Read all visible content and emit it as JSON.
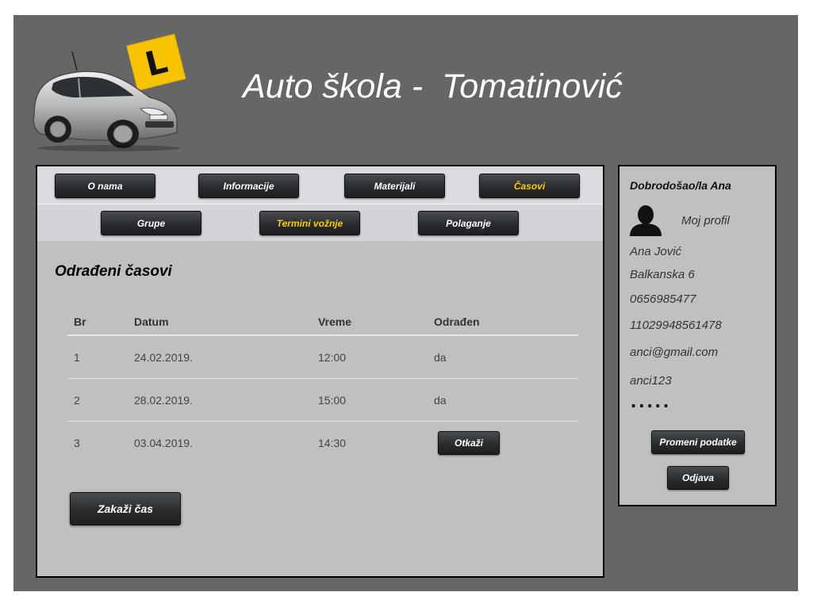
{
  "header": {
    "title": "Auto škola -  Tomatinović",
    "logo_badge": "L"
  },
  "nav": {
    "row1": [
      {
        "label": "O nama",
        "active": false
      },
      {
        "label": "Informacije",
        "active": false
      },
      {
        "label": "Materijali",
        "active": false
      },
      {
        "label": "Časovi",
        "active": true
      }
    ],
    "row2": [
      {
        "label": "Grupe",
        "active": false
      },
      {
        "label": "Termini vožnje",
        "active": true
      },
      {
        "label": "Polaganje",
        "active": false
      }
    ]
  },
  "main": {
    "section_title": "Odrađeni časovi",
    "table": {
      "columns": [
        "Br",
        "Datum",
        "Vreme",
        "Odrađen"
      ],
      "rows": [
        {
          "br": "1",
          "datum": "24.02.2019.",
          "vreme": "12:00",
          "odradjen": "da"
        },
        {
          "br": "2",
          "datum": "28.02.2019.",
          "vreme": "15:00",
          "odradjen": "da"
        },
        {
          "br": "3",
          "datum": "03.04.2019.",
          "vreme": "14:30",
          "odradjen": "",
          "action": "Otkaži"
        }
      ]
    },
    "book_button": "Zakaži čas"
  },
  "sidebar": {
    "welcome": "Dobrodošao/la Ana",
    "profile_link": "Moj profil",
    "name": "Ana Jović",
    "address": "Balkanska 6",
    "phone": "0656985477",
    "jmbg": "11029948561478",
    "email": "anci@gmail.com",
    "username": "anci123",
    "password_mask": ".....",
    "edit_button": "Promeni podatke",
    "logout_button": "Odjava"
  },
  "colors": {
    "background": "#666666",
    "panel": "#c0c0c0",
    "active_nav": "#ffcc00",
    "button": "#2a2c2e"
  }
}
